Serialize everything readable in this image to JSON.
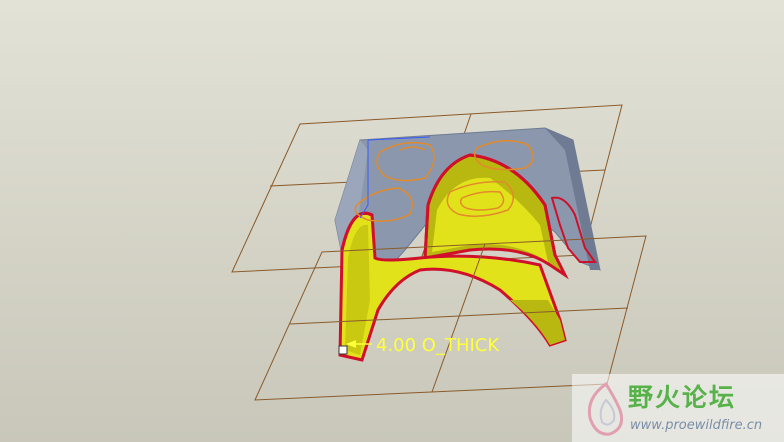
{
  "viewport": {
    "background_top": "#e3e2d7",
    "background_bottom": "#c8c7ba"
  },
  "model": {
    "part_colors": {
      "upper_surface": "#8b97ad",
      "upper_surface_shade": "#6f7b93",
      "inner_surface": "#e2e21a",
      "inner_surface_shade": "#b8b810",
      "edge_highlight": "#d0102a",
      "datum_plane": "#8a5a2a",
      "sketch_curve": "#e38a2a",
      "selection_edge": "#3a5cff"
    }
  },
  "dimension": {
    "label": "4.00 O_THICK",
    "color": "#ffff3a"
  },
  "watermark": {
    "title": "野火论坛",
    "url": "www.proewildfire.cn"
  }
}
